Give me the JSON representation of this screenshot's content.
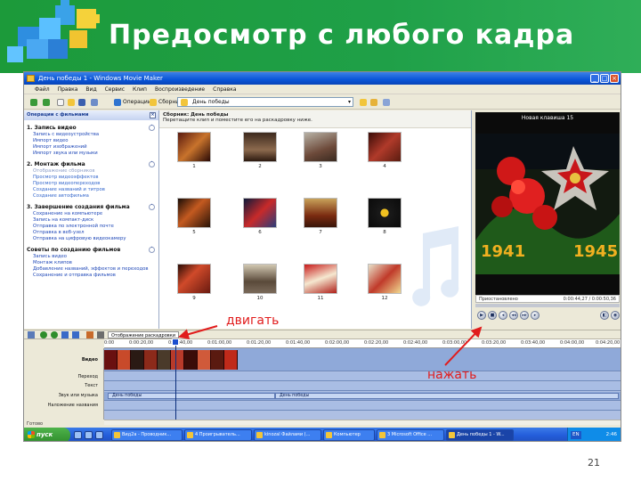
{
  "slide": {
    "title": "Предосмотр с любого кадра",
    "page_number": "21"
  },
  "window": {
    "title": "День победы 1 - Windows Movie Maker"
  },
  "menu": [
    "Файл",
    "Правка",
    "Вид",
    "Сервис",
    "Клип",
    "Воспроизведение",
    "Справка"
  ],
  "toolbar": {
    "tasks_label": "Операции",
    "collections_label": "Сборники",
    "collection_value": "День победы"
  },
  "taskpane": {
    "header": "Операции с фильмами",
    "sections": [
      {
        "title": "1. Запись видео",
        "links": [
          "Запись с видеоустройства",
          "Импорт видео",
          "Импорт изображений",
          "Импорт звука или музыки"
        ]
      },
      {
        "title": "2. Монтаж фильма",
        "links": [
          "Отображение сборников",
          "Просмотр видеоэффектов",
          "Просмотр видеопереходов",
          "Создание названий и титров",
          "Создание автофильма"
        ]
      },
      {
        "title": "3. Завершение создания фильма",
        "links": [
          "Сохранение на компьютере",
          "Запись на компакт-диск",
          "Отправка по электронной почте",
          "Отправка в веб-узел",
          "Отправка на цифровую видеокамеру"
        ]
      },
      {
        "title": "Советы по созданию фильмов",
        "links": [
          "Запись видео",
          "Монтаж клипов",
          "Добавление названий, эффектов и переходов",
          "Сохранение и отправка фильмов"
        ]
      }
    ]
  },
  "collection": {
    "title": "Сборник: День победы",
    "hint": "Перетащите клип и поместите его на раскадровку ниже.",
    "items": [
      "1",
      "2",
      "3",
      "4",
      "5",
      "6",
      "7",
      "8",
      "9",
      "10",
      "11",
      "12"
    ]
  },
  "preview": {
    "clip_title": "Новая клавиша 15",
    "status": "Приостановлено",
    "time": "0:00:44,27 / 0:00:50,36"
  },
  "timeline": {
    "view_toggle": "Отображение раскадровки",
    "ruler": [
      "0:00",
      "0:00:20,00",
      "0:00:40,00",
      "0:01:00,00",
      "0:01:20,00",
      "0:01:40,00",
      "0:02:00,00",
      "0:02:20,00",
      "0:02:40,00",
      "0:03:00,00",
      "0:03:20,00",
      "0:03:40,00",
      "0:04:00,00",
      "0:04:20,00"
    ],
    "tracks": [
      "Видео",
      "Переход",
      "Текст",
      "Звук или музыка",
      "Наложение названия"
    ],
    "audio_clips": [
      "День победы",
      "День победы"
    ]
  },
  "statusbar": {
    "text": "Готово"
  },
  "taskbar": {
    "start": "пуск",
    "windows": [
      "Вид2а - Проводник...",
      "4 Проигрыватель...",
      "kinozal Файлами (...",
      "Компьютер",
      "3 Microsoft Office ...",
      "День победы 1 - W..."
    ],
    "lang": "EN",
    "clock": "2:46"
  },
  "annotations": {
    "drag": "двигать",
    "press": "нажать"
  },
  "colors": {
    "header_green": "#1fa048",
    "annotation_red": "#e11c1c",
    "xp_blue": "#0a55d8"
  }
}
